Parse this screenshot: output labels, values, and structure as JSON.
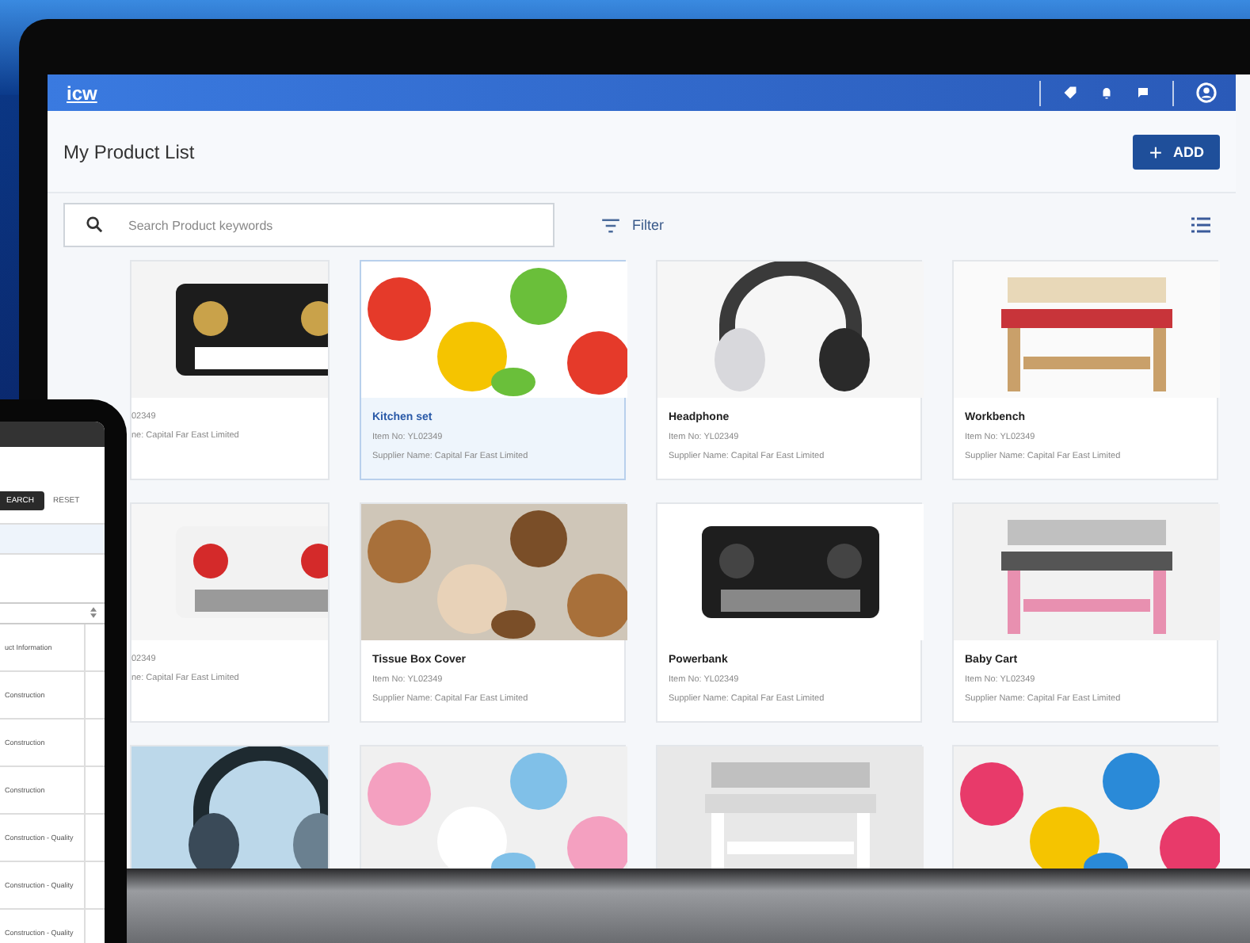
{
  "topbar": {
    "logo": "icw"
  },
  "header": {
    "title": "My Product List",
    "add_button": {
      "icon": "+",
      "label": "ADD"
    }
  },
  "search": {
    "placeholder": "Search Product keywords"
  },
  "filter": {
    "label": "Filter"
  },
  "products": [
    {
      "item_no": "02349",
      "supplier": "ne: Capital Far East Limited",
      "selected": false
    },
    {
      "name": "Kitchen set",
      "item_no": "Item No: YL02349",
      "supplier": "Supplier Name: Capital Far East Limited",
      "selected": true
    },
    {
      "name": "Headphone",
      "item_no": "Item No: YL02349",
      "supplier": "Supplier Name: Capital Far East Limited",
      "selected": false
    },
    {
      "name": "Workbench",
      "item_no": "Item No: YL02349",
      "supplier": "Supplier Name: Capital Far East Limited",
      "selected": false
    },
    {
      "item_no": "02349",
      "supplier": "ne: Capital Far East Limited",
      "selected": false
    },
    {
      "name": "Tissue Box Cover",
      "item_no": "Item No: YL02349",
      "supplier": "Supplier Name: Capital Far East Limited",
      "selected": false
    },
    {
      "name": "Powerbank",
      "item_no": "Item No: YL02349",
      "supplier": "Supplier Name: Capital Far East Limited",
      "selected": false
    },
    {
      "name": "Baby Cart",
      "item_no": "Item No: YL02349",
      "supplier": "Supplier Name: Capital Far East Limited",
      "selected": false
    },
    {
      "selected": false
    },
    {
      "selected": false
    },
    {
      "selected": false
    },
    {
      "selected": false
    }
  ],
  "tablet": {
    "search_button": "EARCH",
    "reset_button": "RESET",
    "rows": [
      "uct Information",
      "Construction",
      "Construction",
      "Construction",
      "Construction - Quality",
      "Construction - Quality",
      "Construction - Quality"
    ]
  }
}
